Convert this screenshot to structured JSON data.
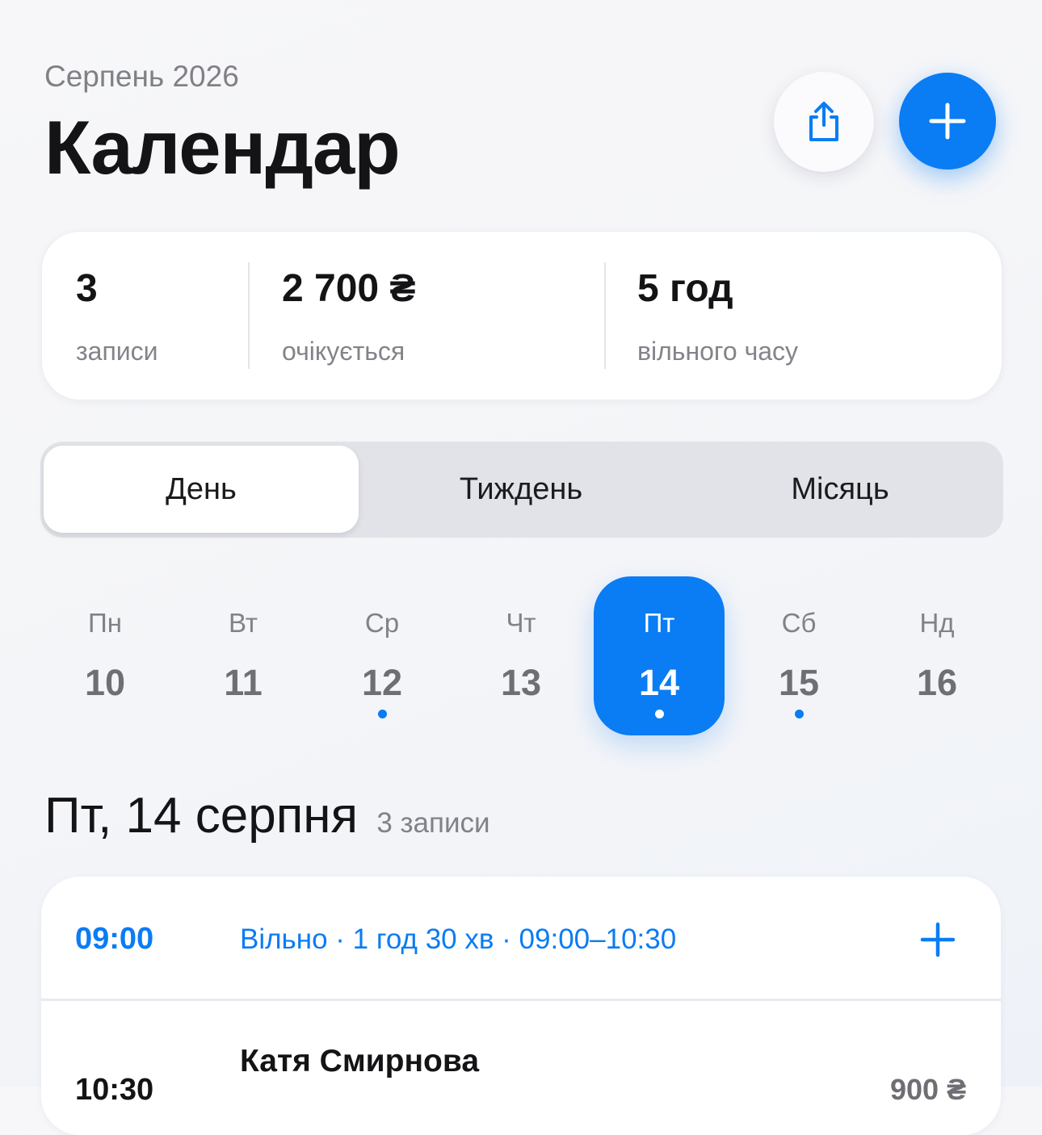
{
  "header": {
    "subtitle": "Серпень 2026",
    "title": "Календар",
    "share_icon": "share-icon",
    "add_icon": "plus-icon"
  },
  "summary": {
    "bookings_value": "3",
    "bookings_label": "записи",
    "expected_value": "2 700 ₴",
    "expected_label": "очікується",
    "free_value": "5 год",
    "free_label": "вільного часу"
  },
  "view_tabs": {
    "day": "День",
    "week": "Тиждень",
    "month": "Місяць",
    "active": "day"
  },
  "week": {
    "days": [
      {
        "name": "Пн",
        "num": "10",
        "has_events": false,
        "selected": false
      },
      {
        "name": "Вт",
        "num": "11",
        "has_events": false,
        "selected": false
      },
      {
        "name": "Ср",
        "num": "12",
        "has_events": true,
        "selected": false
      },
      {
        "name": "Чт",
        "num": "13",
        "has_events": false,
        "selected": false
      },
      {
        "name": "Пт",
        "num": "14",
        "has_events": true,
        "selected": true
      },
      {
        "name": "Сб",
        "num": "15",
        "has_events": true,
        "selected": false
      },
      {
        "name": "Нд",
        "num": "16",
        "has_events": false,
        "selected": false
      }
    ]
  },
  "day_view": {
    "date": "Пт, 14 серпня",
    "count": "3 записи"
  },
  "schedule": {
    "free_slot": {
      "time": "09:00",
      "info": "Вільно · 1 год 30 хв · 09:00–10:30"
    },
    "booking": {
      "time": "10:30",
      "client": "Катя Смирнова",
      "price": "900 ₴"
    }
  },
  "colors": {
    "accent": "#0a7cf4",
    "background": "#f4f5f8",
    "text": "#141416",
    "muted": "#818188"
  }
}
